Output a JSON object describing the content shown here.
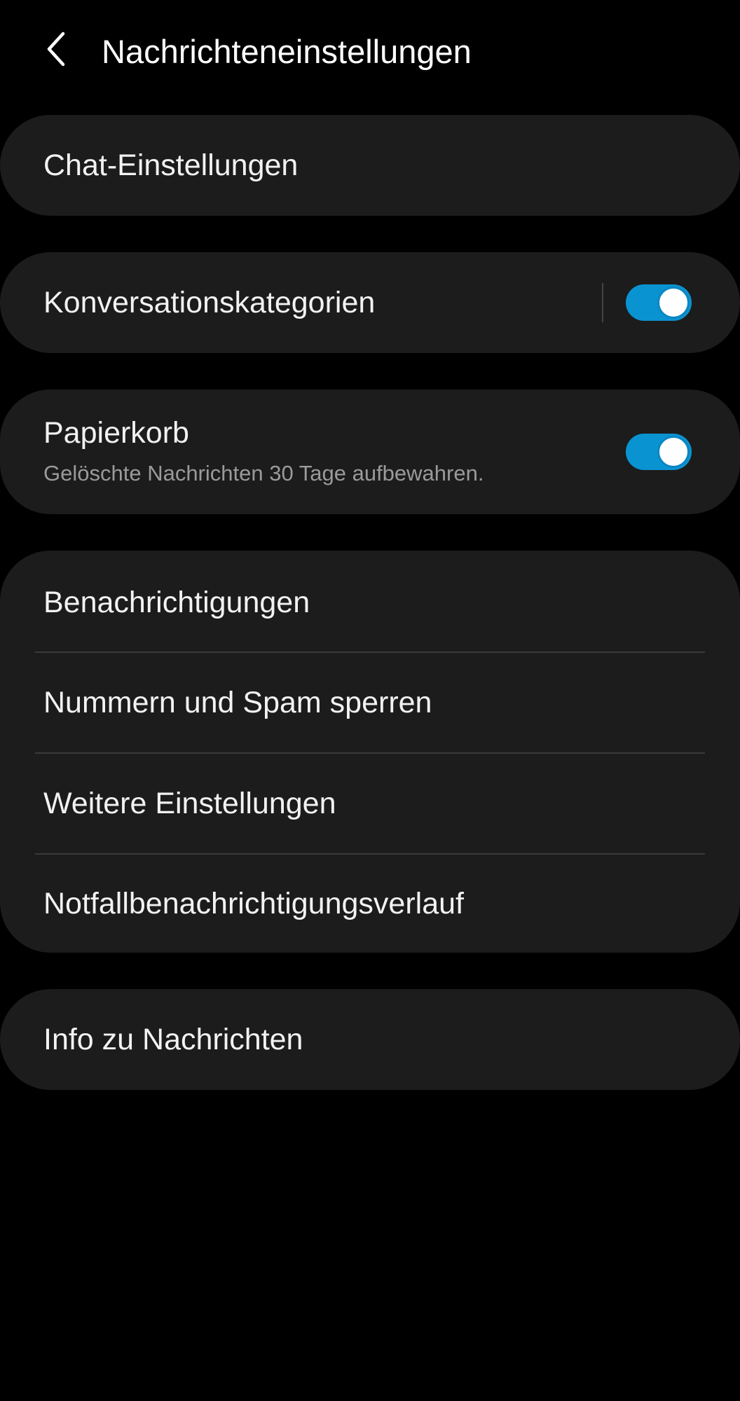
{
  "header": {
    "title": "Nachrichteneinstellungen",
    "back_icon": "chevron-left-icon"
  },
  "colors": {
    "background": "#000000",
    "card": "#1c1c1c",
    "toggle_on": "#0a93d1",
    "secondary_text": "#9a9a9a"
  },
  "chat_settings": {
    "label": "Chat-Einstellungen"
  },
  "conversation_categories": {
    "label": "Konversationskategorien",
    "enabled": true
  },
  "trash": {
    "label": "Papierkorb",
    "description": "Gelöschte Nachrichten 30 Tage aufbewahren.",
    "enabled": true
  },
  "group": {
    "items": [
      {
        "label": "Benachrichtigungen"
      },
      {
        "label": "Nummern und Spam sperren"
      },
      {
        "label": "Weitere Einstellungen"
      },
      {
        "label": "Notfallbenachrichtigungsverlauf"
      }
    ]
  },
  "about": {
    "label": "Info zu Nachrichten"
  }
}
